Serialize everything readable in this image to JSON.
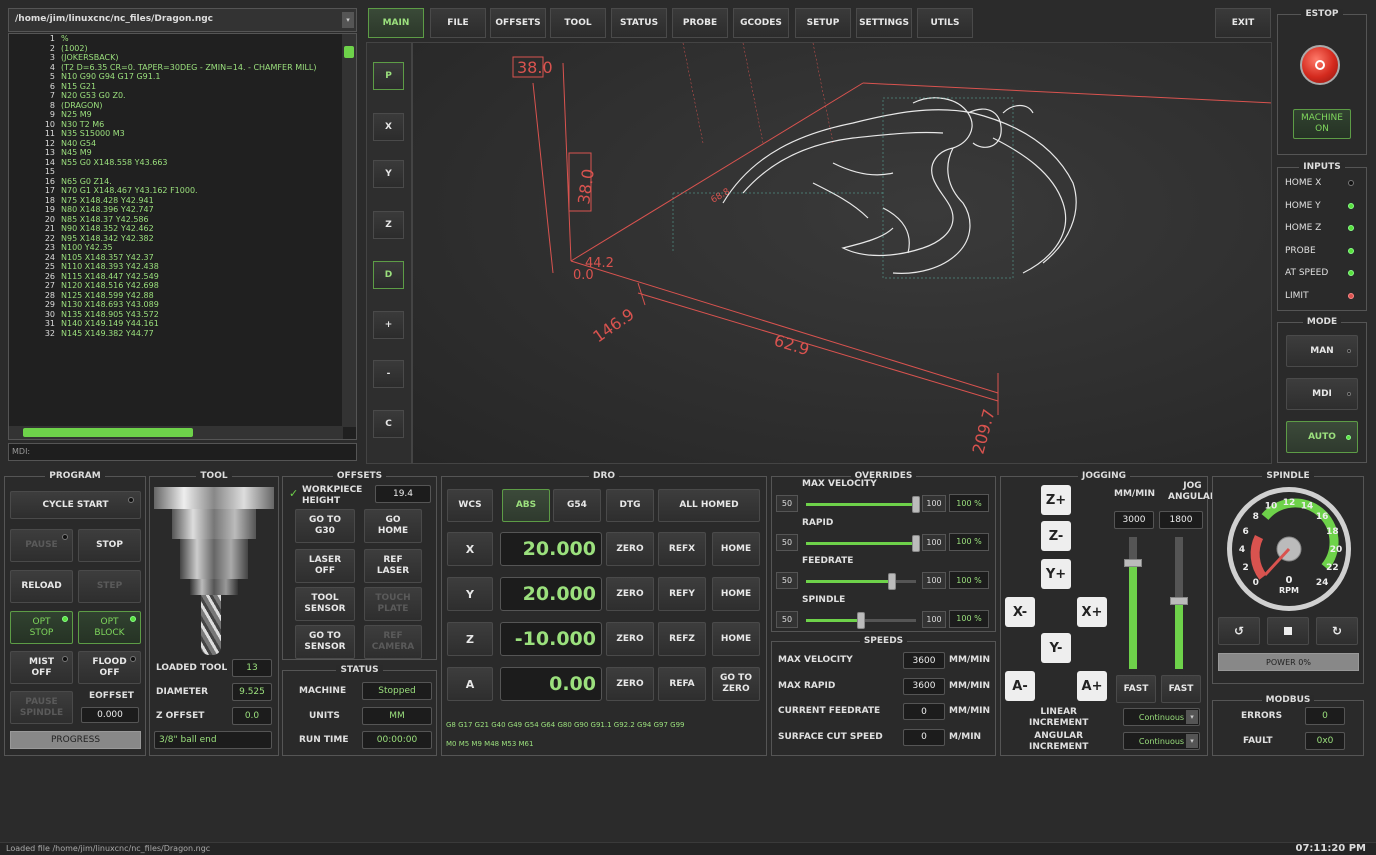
{
  "file_path": "/home/jim/linuxcnc/nc_files/Dragon.ngc",
  "gcode_lines": [
    {
      "n": "1",
      "t": "%"
    },
    {
      "n": "2",
      "t": "(1002)"
    },
    {
      "n": "3",
      "t": "(JOKERSBACK)"
    },
    {
      "n": "4",
      "t": "(T2  D=6.35 CR=0. TAPER=30DEG - ZMIN=14. - CHAMFER MILL)"
    },
    {
      "n": "5",
      "t": "N10 G90 G94 G17 G91.1"
    },
    {
      "n": "6",
      "t": "N15 G21"
    },
    {
      "n": "7",
      "t": "N20 G53 G0 Z0."
    },
    {
      "n": "8",
      "t": "(DRAGON)"
    },
    {
      "n": "9",
      "t": "N25 M9"
    },
    {
      "n": "10",
      "t": "N30 T2 M6"
    },
    {
      "n": "11",
      "t": "N35 S15000 M3"
    },
    {
      "n": "12",
      "t": "N40 G54"
    },
    {
      "n": "13",
      "t": "N45 M9"
    },
    {
      "n": "14",
      "t": "N55 G0 X148.558 Y43.663"
    },
    {
      "n": "15",
      "t": ""
    },
    {
      "n": "16",
      "t": "N65 G0 Z14."
    },
    {
      "n": "17",
      "t": "N70 G1 X148.467 Y43.162 F1000."
    },
    {
      "n": "18",
      "t": "N75 X148.428 Y42.941"
    },
    {
      "n": "19",
      "t": "N80 X148.396 Y42.747"
    },
    {
      "n": "20",
      "t": "N85 X148.37 Y42.586"
    },
    {
      "n": "21",
      "t": "N90 X148.352 Y42.462"
    },
    {
      "n": "22",
      "t": "N95 X148.342 Y42.382"
    },
    {
      "n": "23",
      "t": "N100 Y42.35"
    },
    {
      "n": "24",
      "t": "N105 X148.357 Y42.37"
    },
    {
      "n": "25",
      "t": "N110 X148.393 Y42.438"
    },
    {
      "n": "26",
      "t": "N115 X148.447 Y42.549"
    },
    {
      "n": "27",
      "t": "N120 X148.516 Y42.698"
    },
    {
      "n": "28",
      "t": "N125 X148.599 Y42.88"
    },
    {
      "n": "29",
      "t": "N130 X148.693 Y43.089"
    },
    {
      "n": "30",
      "t": "N135 X148.905 Y43.572"
    },
    {
      "n": "31",
      "t": "N140 X149.149 Y44.161"
    },
    {
      "n": "32",
      "t": "N145 X149.382 Y44.77"
    }
  ],
  "mdi_label": "MDI:",
  "tabs": [
    "MAIN",
    "FILE",
    "OFFSETS",
    "TOOL",
    "STATUS",
    "PROBE",
    "GCODES",
    "SETUP",
    "SETTINGS",
    "UTILS"
  ],
  "exit_label": "EXIT",
  "view_buttons": [
    "P",
    "X",
    "Y",
    "Z",
    "D",
    "+",
    "-",
    "C"
  ],
  "preview_dims": {
    "d1": "38.0",
    "d2": "38.0",
    "d3": "44.2",
    "d4": "0.0",
    "d5": "146.9",
    "d6": "62.9",
    "d7": "209.7",
    "d8": "68.8"
  },
  "estop": {
    "title": "ESTOP",
    "machine_on": "MACHINE\nON"
  },
  "inputs": {
    "title": "INPUTS",
    "items": [
      {
        "label": "HOME X",
        "state": "off"
      },
      {
        "label": "HOME Y",
        "state": "on"
      },
      {
        "label": "HOME Z",
        "state": "on"
      },
      {
        "label": "PROBE",
        "state": "on"
      },
      {
        "label": "AT SPEED",
        "state": "on"
      },
      {
        "label": "LIMIT",
        "state": "red"
      }
    ]
  },
  "mode": {
    "title": "MODE",
    "items": [
      "MAN",
      "MDI",
      "AUTO"
    ]
  },
  "program": {
    "title": "PROGRAM",
    "cycle_start": "CYCLE START",
    "pause": "PAUSE",
    "stop": "STOP",
    "reload": "RELOAD",
    "step": "STEP",
    "opt_stop": "OPT\nSTOP",
    "opt_block": "OPT\nBLOCK",
    "mist": "MIST\nOFF",
    "flood": "FLOOD\nOFF",
    "pause_spindle": "PAUSE\nSPINDLE",
    "eoffset_label": "EOFFSET",
    "eoffset_value": "0.000",
    "progress": "PROGRESS"
  },
  "tool": {
    "title": "TOOL",
    "loaded_tool_label": "LOADED TOOL",
    "loaded_tool": "13",
    "diameter_label": "DIAMETER",
    "diameter": "9.525",
    "zoffset_label": "Z OFFSET",
    "zoffset": "0.0",
    "description": "3/8\" ball end"
  },
  "offsets": {
    "title": "OFFSETS",
    "workpiece_label": "WORKPIECE\nHEIGHT",
    "workpiece": "19.4",
    "go_g30": "GO TO\nG30",
    "go_home": "GO\nHOME",
    "laser_off": "LASER\nOFF",
    "ref_laser": "REF\nLASER",
    "tool_sensor": "TOOL\nSENSOR",
    "touch_plate": "TOUCH\nPLATE",
    "go_sensor": "GO TO\nSENSOR",
    "ref_camera": "REF\nCAMERA"
  },
  "status": {
    "title": "STATUS",
    "machine_label": "MACHINE",
    "machine": "Stopped",
    "units_label": "UNITS",
    "units": "MM",
    "runtime_label": "RUN TIME",
    "runtime": "00:00:00"
  },
  "dro": {
    "title": "DRO",
    "wcs": "WCS",
    "abs": "ABS",
    "g54": "G54",
    "dtg": "DTG",
    "all_homed": "ALL HOMED",
    "axes": [
      {
        "axis": "X",
        "value": "20.000",
        "zero": "ZERO",
        "ref": "REFX",
        "home": "HOME"
      },
      {
        "axis": "Y",
        "value": "20.000",
        "zero": "ZERO",
        "ref": "REFY",
        "home": "HOME"
      },
      {
        "axis": "Z",
        "value": "-10.000",
        "zero": "ZERO",
        "ref": "REFZ",
        "home": "HOME"
      },
      {
        "axis": "A",
        "value": "0.00",
        "zero": "ZERO",
        "ref": "REFA",
        "home": "GO TO\nZERO"
      }
    ],
    "gcodes": "G8 G17 G21 G40 G49 G54 G64 G80 G90 G91.1 G92.2 G94 G97 G99",
    "mcodes": "M0 M5 M9 M48 M53 M61"
  },
  "overrides": {
    "title": "OVERRIDES",
    "items": [
      {
        "label": "MAX VELOCITY",
        "min": "50",
        "max": "100",
        "pct": "100 %",
        "level": 1.0
      },
      {
        "label": "RAPID",
        "min": "50",
        "max": "100",
        "pct": "100 %",
        "level": 1.0
      },
      {
        "label": "FEEDRATE",
        "min": "50",
        "max": "100",
        "pct": "100 %",
        "level": 0.78
      },
      {
        "label": "SPINDLE",
        "min": "50",
        "max": "100",
        "pct": "100 %",
        "level": 0.5
      }
    ]
  },
  "speeds": {
    "title": "SPEEDS",
    "items": [
      {
        "label": "MAX VELOCITY",
        "value": "3600",
        "unit": "MM/MIN"
      },
      {
        "label": "MAX RAPID",
        "value": "3600",
        "unit": "MM/MIN"
      },
      {
        "label": "CURRENT FEEDRATE",
        "value": "0",
        "unit": "MM/MIN"
      },
      {
        "label": "SURFACE CUT SPEED",
        "value": "0",
        "unit": "M/MIN"
      }
    ]
  },
  "jogging": {
    "title": "JOGGING",
    "mm_min": "MM/MIN",
    "jog_angular": "JOG\nANGULAR",
    "rate": "3000",
    "angular_rate": "1800",
    "fast": "FAST",
    "fast2": "FAST",
    "linear_inc": "LINEAR\nINCREMENT",
    "angular_inc": "ANGULAR\nINCREMENT",
    "linear_val": "Continuous",
    "angular_val": "Continuous",
    "buttons": [
      "Z+",
      "Z-",
      "Y+",
      "X-",
      "X+",
      "Y-",
      "A-",
      "A+"
    ]
  },
  "spindle": {
    "title": "SPINDLE",
    "rpm_label": "RPM",
    "rpm": "0",
    "ticks": [
      "0",
      "2",
      "4",
      "6",
      "8",
      "10",
      "12",
      "14",
      "16",
      "18",
      "20",
      "22",
      "24"
    ],
    "power": "POWER 0%"
  },
  "modbus": {
    "title": "MODBUS",
    "errors_label": "ERRORS",
    "errors": "0",
    "fault_label": "FAULT",
    "fault": "0x0"
  },
  "statusbar": {
    "message": "Loaded file /home/jim/linuxcnc/nc_files/Dragon.ngc",
    "time": "07:11:20 PM"
  }
}
